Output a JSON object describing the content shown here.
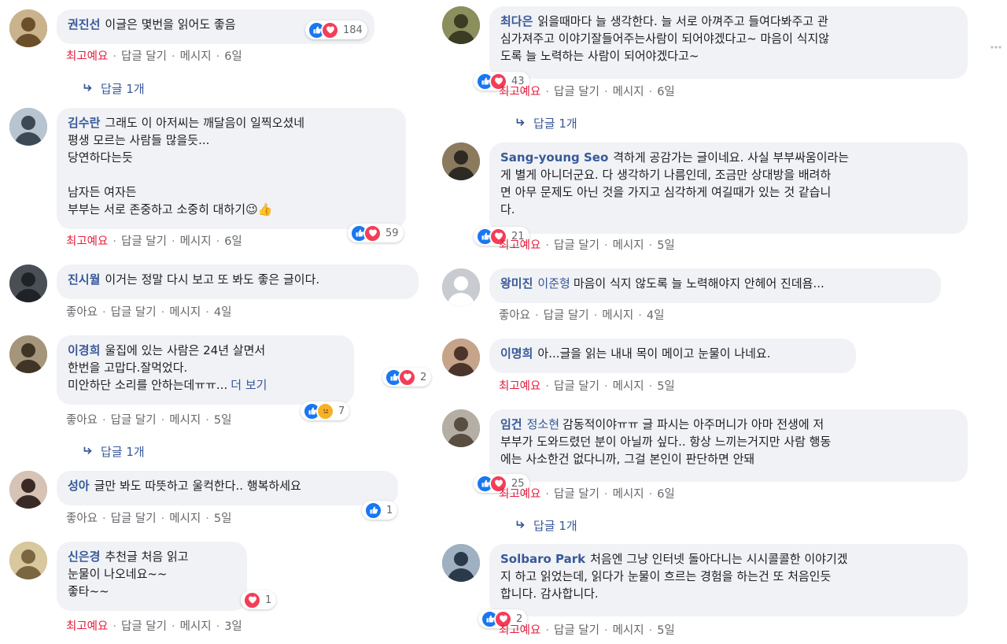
{
  "left": [
    {
      "author": "권진선",
      "tag": "",
      "text": "이글은 몇번을 읽어도 좋음",
      "more": "",
      "reaction_count": "184",
      "reactions": [
        "like",
        "love"
      ],
      "actions": {
        "like": "최고예요",
        "reply": "답글 달기",
        "message": "메시지",
        "time": "6일"
      },
      "top": true,
      "reply_count": "답글 1개"
    },
    {
      "author": "김수란",
      "tag": "",
      "text": "그래도 이 아저씨는 깨달음이 일찍오셨네\n평생 모르는 사람들 많을듯...\n당연하다는듯\n\n남자든 여자든\n부부는 서로 존중하고 소중히 대하기😉👍",
      "more": "",
      "reaction_count": "59",
      "reactions": [
        "like",
        "love"
      ],
      "actions": {
        "like": "최고예요",
        "reply": "답글 달기",
        "message": "메시지",
        "time": "6일"
      },
      "top": true,
      "reply_count": ""
    },
    {
      "author": "진시월",
      "tag": "",
      "text": "이거는 정말 다시 보고 또 봐도 좋은 글이다.",
      "more": "",
      "reaction_count": "",
      "reactions": [],
      "actions": {
        "like": "좋아요",
        "reply": "답글 달기",
        "message": "메시지",
        "time": "4일"
      },
      "top": false,
      "reply_count": ""
    },
    {
      "author": "이경희",
      "tag": "",
      "text": "울집에 있는 사람은 24년 살면서\n한번을 고맙다.잘먹었다.\n미안하단 소리를 안하는데ㅠㅠ...",
      "more": "더 보기",
      "reaction_count": "7",
      "reactions": [
        "like",
        "sad"
      ],
      "actions": {
        "like": "좋아요",
        "reply": "답글 달기",
        "message": "메시지",
        "time": "5일"
      },
      "top": false,
      "reply_count": "답글 1개"
    },
    {
      "author": "성아",
      "tag": "",
      "text": "글만 봐도 따뜻하고 울컥한다.. 행복하세요",
      "more": "",
      "reaction_count": "1",
      "reactions": [
        "like"
      ],
      "actions": {
        "like": "좋아요",
        "reply": "답글 달기",
        "message": "메시지",
        "time": "5일"
      },
      "top": false,
      "reply_count": ""
    },
    {
      "author": "신은경",
      "tag": "",
      "text": "추천글 처음 읽고\n눈물이 나오네요~~\n좋타~~",
      "more": "",
      "reaction_count": "1",
      "reactions": [
        "love"
      ],
      "actions": {
        "like": "최고예요",
        "reply": "답글 달기",
        "message": "메시지",
        "time": "3일"
      },
      "top": true,
      "reply_count": ""
    }
  ],
  "right": [
    {
      "author": "최다은",
      "tag": "",
      "text": "읽을때마다 늘 생각한다. 늘 서로 아껴주고 들여다봐주고 관\n심가져주고 이야기잘들어주는사람이 되어야겠다고~ 마음이 식지않\n도록 늘 노력하는 사람이 되어야겠다고~",
      "more": "",
      "reaction_count": "43",
      "reactions": [
        "like",
        "love"
      ],
      "actions": {
        "like": "최고예요",
        "reply": "답글 달기",
        "message": "메시지",
        "time": "6일"
      },
      "top": true,
      "reply_count": "답글 1개"
    },
    {
      "author": "Sang-young Seo",
      "tag": "",
      "text": "격하게 공감가는 글이네요. 사실 부부싸움이라는\n게 별게 아니더군요. 다 생각하기 나름인데, 조금만 상대방을 배려하\n면 아무 문제도 아닌 것을 가지고 심각하게 여길때가 있는 것 같습니\n다.",
      "more": "",
      "reaction_count": "21",
      "reactions": [
        "like",
        "love"
      ],
      "actions": {
        "like": "최고예요",
        "reply": "답글 달기",
        "message": "메시지",
        "time": "5일"
      },
      "top": true,
      "reply_count": ""
    },
    {
      "author": "왕미진",
      "tag": "이준형",
      "text": "마음이 식지 않도록 늘 노력해야지 안헤어 진데욤...",
      "more": "",
      "reaction_count": "",
      "reactions": [],
      "actions": {
        "like": "좋아요",
        "reply": "답글 달기",
        "message": "메시지",
        "time": "4일"
      },
      "top": false,
      "reply_count": ""
    },
    {
      "author": "이명희",
      "tag": "",
      "text": "아...글을 읽는 내내 목이 메이고 눈물이 나네요.",
      "more": "",
      "reaction_count": "2",
      "reactions": [
        "like",
        "love"
      ],
      "actions": {
        "like": "최고예요",
        "reply": "답글 달기",
        "message": "메시지",
        "time": "5일"
      },
      "top": true,
      "reply_count": ""
    },
    {
      "author": "임건",
      "tag": "정소현",
      "text": "감동적이야ㅠㅠ 글 파시는 아주머니가 아마 전생에 저\n부부가 도와드렸던 분이 아닐까 싶다.. 항상 느끼는거지만 사람 행동\n에는 사소한건 없다니까, 그걸 본인이 판단하면 안돼",
      "more": "",
      "reaction_count": "25",
      "reactions": [
        "like",
        "love"
      ],
      "actions": {
        "like": "최고예요",
        "reply": "답글 달기",
        "message": "메시지",
        "time": "6일"
      },
      "top": true,
      "reply_count": "답글 1개"
    },
    {
      "author": "Solbaro Park",
      "tag": "",
      "text": "처음엔 그냥 인터넷 돌아다니는 시시콜콜한 이야기겠\n지 하고 읽었는데, 읽다가 눈물이 흐르는 경험을 하는건 또 처음인듯\n합니다. 감사합니다.",
      "more": "",
      "reaction_count": "2",
      "reactions": [
        "like",
        "love"
      ],
      "actions": {
        "like": "최고예요",
        "reply": "답글 달기",
        "message": "메시지",
        "time": "5일"
      },
      "top": true,
      "reply_count": ""
    }
  ],
  "colors": {
    "link": "#385898",
    "top_reaction": "#e41e3f",
    "muted": "#65676b",
    "bubble": "#f0f2f5",
    "like": "#1877f2",
    "love": "#f33e58",
    "sad": "#f7b125"
  },
  "icons": {
    "like": "thumbs-up-icon",
    "love": "heart-icon",
    "sad": "sad-face-icon",
    "reply": "reply-arrow-icon",
    "scroll": "scroll-arrow-icon"
  }
}
